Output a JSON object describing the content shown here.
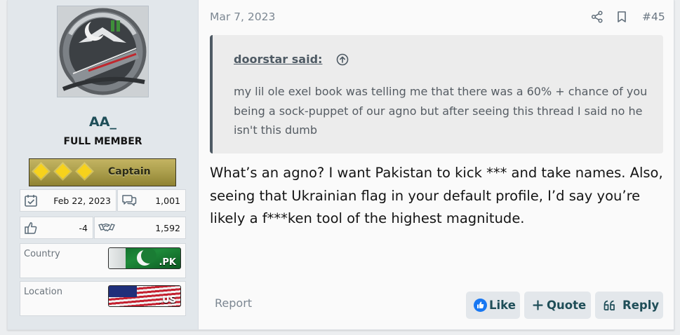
{
  "user": {
    "name": "AA_",
    "title": "FULL MEMBER",
    "rank": "Captain",
    "joined": "Feb 22, 2023",
    "messages": "1,001",
    "reaction_score": "-4",
    "points": "1,592",
    "country_label": "Country",
    "country_code": ".PK",
    "location_label": "Location",
    "location_code": ".US"
  },
  "post": {
    "date": "Mar 7, 2023",
    "number": "#45",
    "quote_author": "doorstar said:",
    "quote_text": "my lil ole exel book was telling me that there was a 60% + chance of you being a sock-puppet of our agno but after seeing this thread I said no he isn't this dumb",
    "body": "What’s an agno? I want Pakistan to kick *** and take names. Also, seeing that Ukrainian flag in your default profile, I’d say you’re likely a f***ken tool of the highest magnitude."
  },
  "actions": {
    "report": "Report",
    "like": "Like",
    "quote": "Quote",
    "reply": "Reply"
  },
  "colors": {
    "accent": "#1f4e58",
    "sidebar": "#e2e7eb",
    "button_bg": "#e3e7eb",
    "rank_diamond": "#f7d21c"
  },
  "icons": [
    "share-icon",
    "bookmark-icon",
    "arrow-up-circle-icon",
    "calendar-check-icon",
    "comments-icon",
    "thumbs-up-icon",
    "handshake-icon",
    "like-icon",
    "plus-icon",
    "quote-reply-icon"
  ]
}
